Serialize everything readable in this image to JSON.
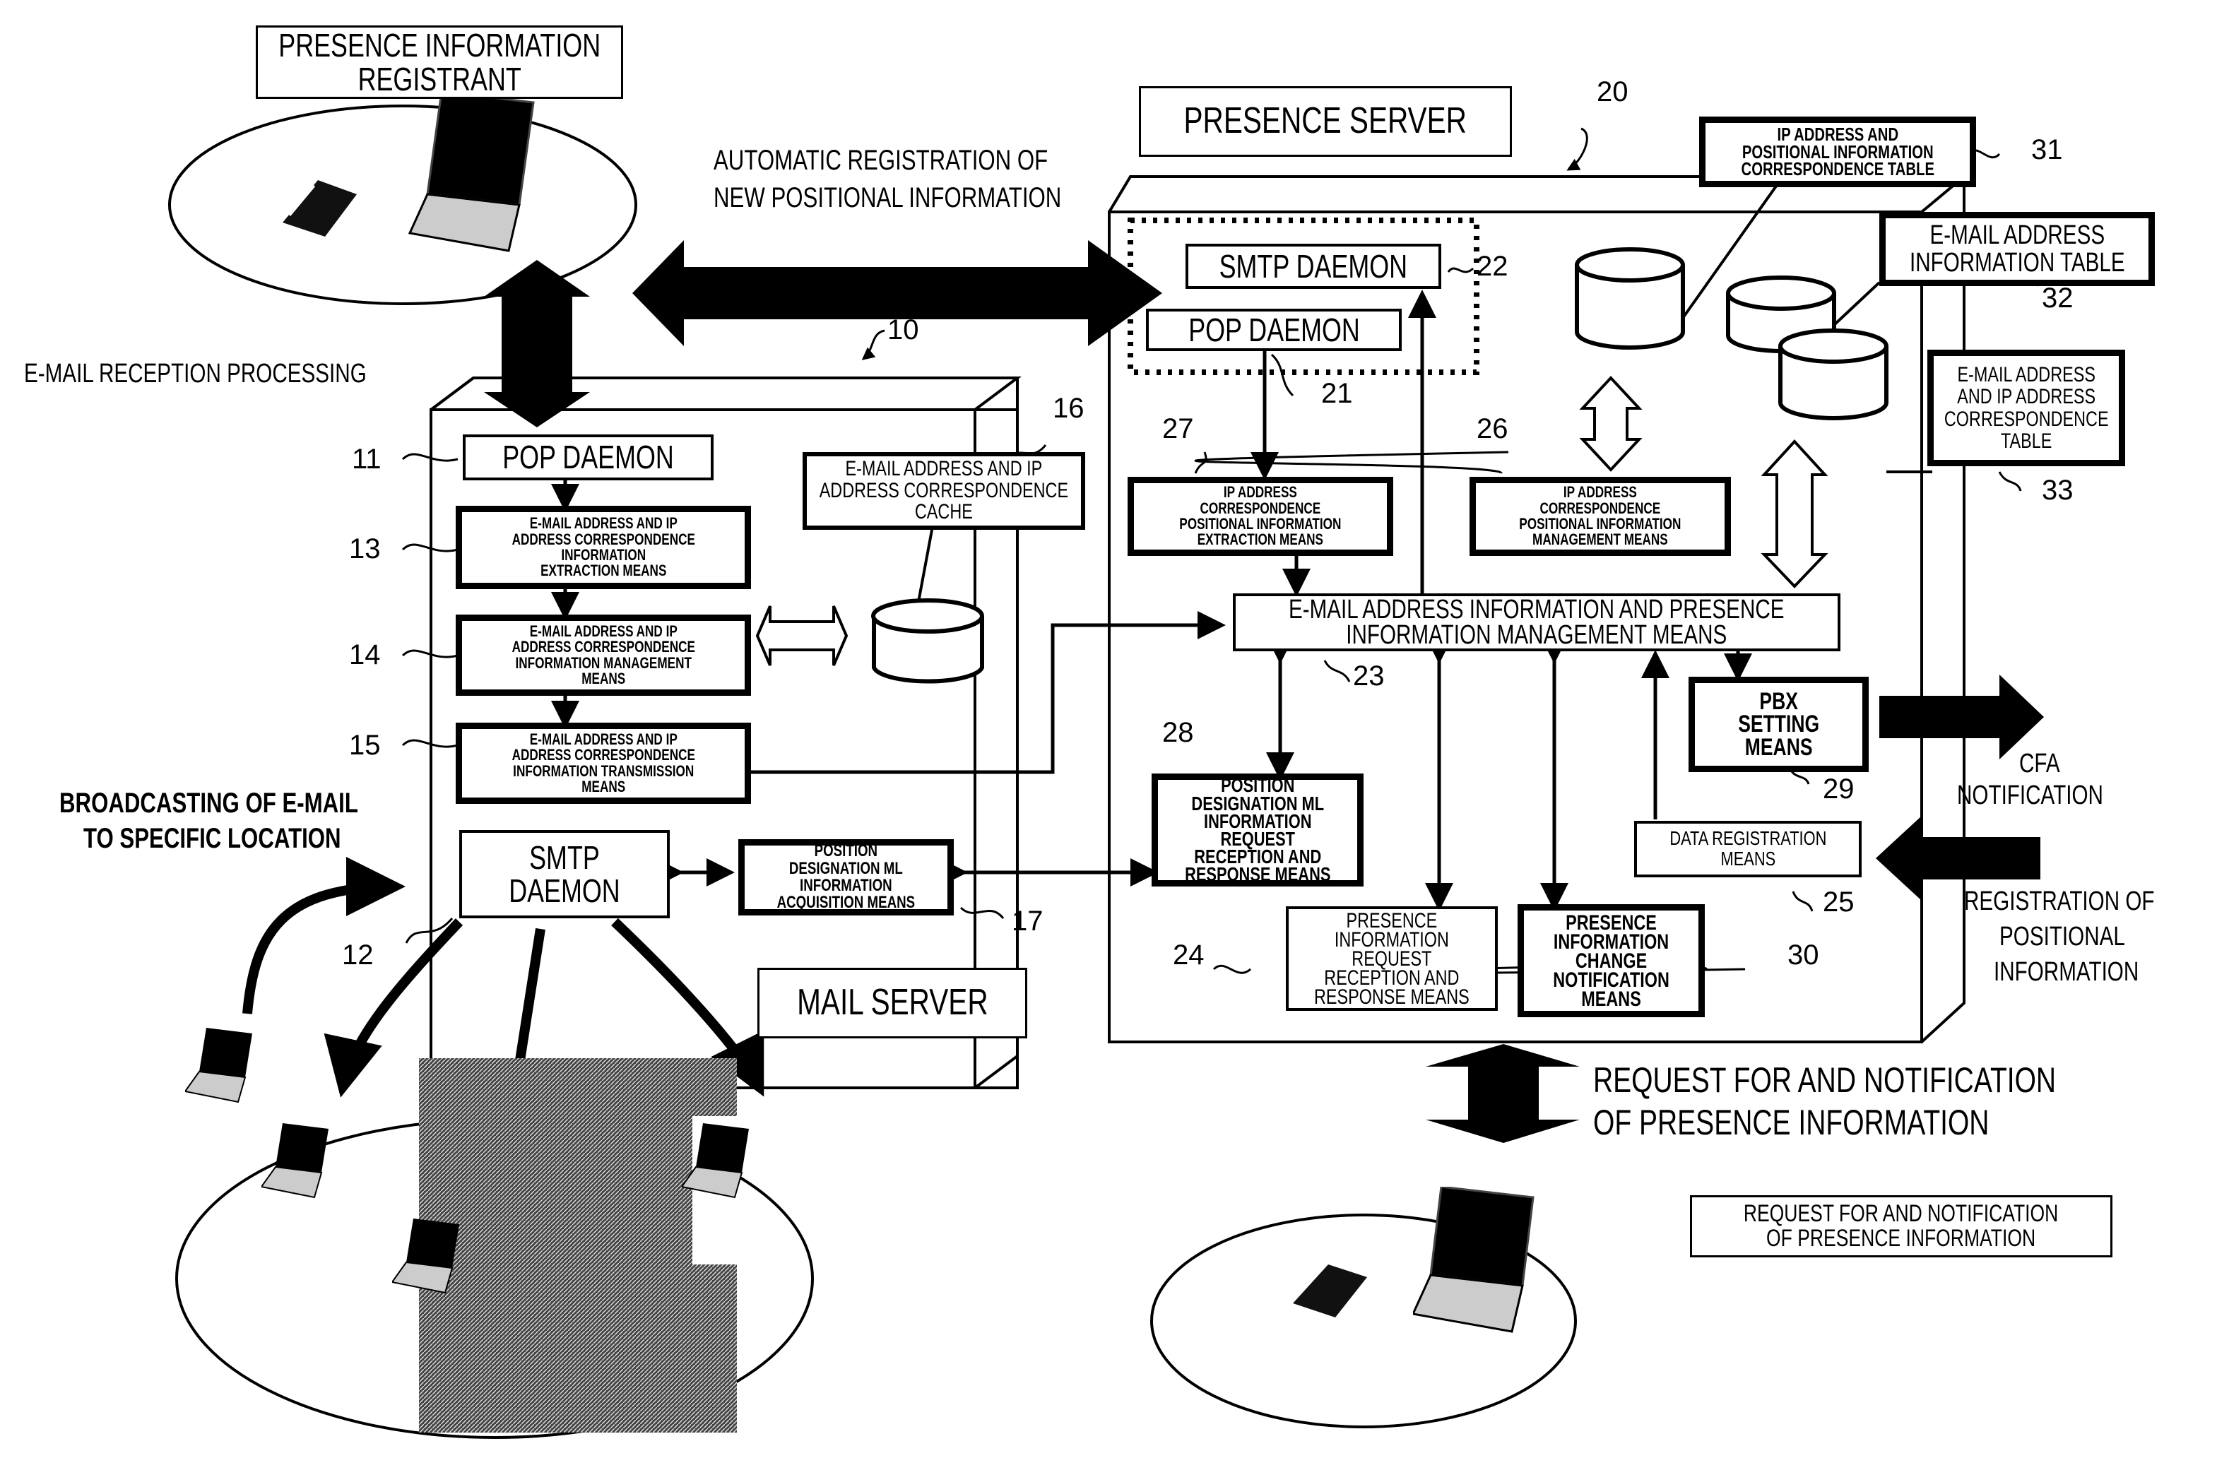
{
  "labels": {
    "registrant": "PRESENCE INFORMATION\nREGISTRANT",
    "auto_registration_1": "AUTOMATIC REGISTRATION OF",
    "auto_registration_2": "NEW POSITIONAL INFORMATION",
    "email_reception": "E-MAIL RECEPTION PROCESSING",
    "broadcasting_1": "BROADCASTING OF E-MAIL",
    "broadcasting_2": "TO SPECIFIC LOCATION",
    "mail_server": "MAIL SERVER",
    "presence_server": "PRESENCE SERVER",
    "cfa_1": "CFA",
    "cfa_2": "NOTIFICATION",
    "registration_pos_1": "REGISTRATION OF",
    "registration_pos_2": "POSITIONAL",
    "registration_pos_3": "INFORMATION",
    "request_notification_1": "REQUEST FOR AND NOTIFICATION",
    "request_notification_2": "OF PRESENCE INFORMATION",
    "request_notification_box": "REQUEST FOR AND NOTIFICATION\nOF PRESENCE INFORMATION"
  },
  "mail_server": {
    "ref": "10",
    "pop_daemon": {
      "ref": "11",
      "label": "POP DAEMON"
    },
    "smtp_daemon": {
      "ref": "12",
      "label": "SMTP\nDAEMON"
    },
    "extraction": {
      "ref": "13",
      "label": "E-MAIL ADDRESS AND IP\nADDRESS CORRESPONDENCE\nINFORMATION\nEXTRACTION MEANS"
    },
    "management": {
      "ref": "14",
      "label": "E-MAIL ADDRESS AND IP\nADDRESS CORRESPONDENCE\nINFORMATION MANAGEMENT\nMEANS"
    },
    "transmission": {
      "ref": "15",
      "label": "E-MAIL ADDRESS AND IP\nADDRESS CORRESPONDENCE\nINFORMATION TRANSMISSION\nMEANS"
    },
    "cache": {
      "ref": "16",
      "label": "E-MAIL ADDRESS AND IP\nADDRESS CORRESPONDENCE\nCACHE"
    },
    "ml_acquisition": {
      "ref": "17",
      "label": "POSITION\nDESIGNATION ML\nINFORMATION\nACQUISITION MEANS"
    }
  },
  "presence_server": {
    "ref": "20",
    "pop_daemon": {
      "ref": "21",
      "label": "POP DAEMON"
    },
    "smtp_daemon": {
      "ref": "22",
      "label": "SMTP DAEMON"
    },
    "main_management": {
      "ref": "23",
      "label": "E-MAIL ADDRESS INFORMATION AND PRESENCE\nINFORMATION MANAGEMENT MEANS"
    },
    "presence_request": {
      "ref": "24",
      "label": "PRESENCE\nINFORMATION\nREQUEST\nRECEPTION AND\nRESPONSE MEANS"
    },
    "data_registration": {
      "ref": "25",
      "label": "DATA REGISTRATION\nMEANS"
    },
    "ip_pos_management": {
      "ref": "26",
      "label": "IP ADDRESS\nCORRESPONDENCE\nPOSITIONAL INFORMATION\nMANAGEMENT MEANS"
    },
    "ip_pos_extraction": {
      "ref": "27",
      "label": "IP ADDRESS\nCORRESPONDENCE\nPOSITIONAL INFORMATION\nEXTRACTION MEANS"
    },
    "ml_request": {
      "ref": "28",
      "label": "POSITION\nDESIGNATION ML\nINFORMATION\nREQUEST\nRECEPTION AND\nRESPONSE MEANS"
    },
    "pbx_setting": {
      "ref": "29",
      "label": "PBX\nSETTING\nMEANS"
    },
    "change_notification": {
      "ref": "30",
      "label": "PRESENCE\nINFORMATION\nCHANGE\nNOTIFICATION\nMEANS"
    },
    "ip_pos_table": {
      "ref": "31",
      "label": "IP ADDRESS AND\nPOSITIONAL INFORMATION\nCORRESPONDENCE TABLE"
    },
    "email_table": {
      "ref": "32",
      "label": "E-MAIL ADDRESS\nINFORMATION TABLE"
    },
    "email_ip_table": {
      "ref": "33",
      "label": "E-MAIL ADDRESS\nAND IP ADDRESS\nCORRESPONDENCE\nTABLE"
    }
  }
}
